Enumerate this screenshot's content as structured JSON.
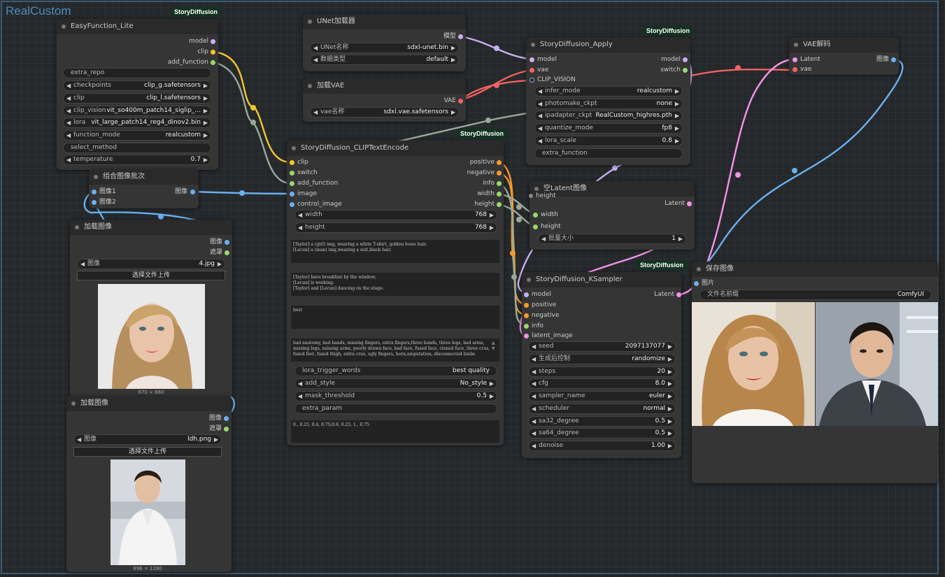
{
  "group_title": "RealCustom",
  "badge_label": "StoryDiffusion",
  "easy": {
    "title": "EasyFunction_Lite",
    "outputs": [
      "model",
      "clip",
      "add_function"
    ],
    "extra_repo": "extra_repo",
    "widgets": [
      {
        "label": "checkpoints",
        "value": "clip_g.safetensors"
      },
      {
        "label": "clip",
        "value": "clip_l.safetensors"
      },
      {
        "label": "clip_vision",
        "value": "vit_so400m_patch14_siglip_..."
      },
      {
        "label": "lora",
        "value": "vit_large_patch14_reg4_dinov2.bin"
      },
      {
        "label": "function_mode",
        "value": "realcustom"
      }
    ],
    "select_method": "select_method",
    "temperature": {
      "label": "temperature",
      "value": "0.7"
    }
  },
  "unet": {
    "title": "UNet加载器",
    "output": "模型",
    "widgets": [
      {
        "label": "UNet名称",
        "value": "sdxl-unet.bin"
      },
      {
        "label": "数据类型",
        "value": "default"
      }
    ]
  },
  "vae_loader": {
    "title": "加载VAE",
    "output": "VAE",
    "widget": {
      "label": "vae名称",
      "value": "sdxl.vae.safetensors"
    }
  },
  "apply": {
    "title": "StoryDiffusion_Apply",
    "inputs": [
      "model",
      "vae",
      "CLIP_VISION"
    ],
    "outputs": [
      "model",
      "switch"
    ],
    "widgets": [
      {
        "label": "infer_mode",
        "value": "realcustom"
      },
      {
        "label": "photomake_ckpt",
        "value": "none"
      },
      {
        "label": "ipadapter_ckpt",
        "value": "RealCustom_highres.pth"
      },
      {
        "label": "quantize_mode",
        "value": "fp8"
      },
      {
        "label": "lora_scale",
        "value": "0.8"
      }
    ],
    "extra_function": "extra_function"
  },
  "vae_decode": {
    "title": "VAE解码",
    "inputs": [
      "Latent",
      "vae"
    ],
    "output": "图像"
  },
  "combine": {
    "title": "组合图像批次",
    "inputs": [
      "图像1",
      "图像2"
    ],
    "output": "图像"
  },
  "clipenc": {
    "title": "StoryDiffusion_CLIPTextEncode",
    "inputs": [
      "clip",
      "switch",
      "add_function",
      "image",
      "control_image"
    ],
    "outputs": [
      "positive",
      "negative",
      "info",
      "width",
      "height"
    ],
    "width": {
      "label": "width",
      "value": "768"
    },
    "height": {
      "label": "height",
      "value": "768"
    },
    "text1": "[Taylor] a (girl) img, wearing a white T-shirt, golden loose hair.\n[Lecun] a (man) img,wearing a suit,black hair.",
    "text2": "[Taylor] have breakfast by the window;\n[Lecun] is working.\n[Taylor] and [Lecun] dancing on the stage.",
    "text3": "best",
    "text4": "bad anatomy, bad hands, missing fingers, extra fingers,three hands, three legs, bad arms, missing legs, missing arms, poorly drawn face, bad face, fused face, cloned face, three crus, fused feet, fused thigh, extra crus, ugly fingers, horn,amputation, disconnected limbs",
    "widgets": [
      {
        "label": "lora_trigger_words",
        "value": "best quality"
      },
      {
        "label": "add_style",
        "value": "No_style"
      },
      {
        "label": "mask_threshold",
        "value": "0.5"
      }
    ],
    "extra_param": "extra_param",
    "text5": "0., 0.25, 0.4, 0.75;0.6, 0.25, 1., 0.75"
  },
  "latent": {
    "title": "空Latent图像",
    "inputs": [
      "height",
      "width",
      "height"
    ],
    "output": "Latent",
    "batch": {
      "label": "批量大小",
      "value": "1"
    }
  },
  "ksampler": {
    "title": "StoryDiffusion_KSampler",
    "inputs": [
      "model",
      "positive",
      "negative",
      "info",
      "latent_image"
    ],
    "output": "Latent",
    "widgets": [
      {
        "label": "seed",
        "value": "2097137077"
      },
      {
        "label": "生成后控制",
        "value": "randomize"
      },
      {
        "label": "steps",
        "value": "20"
      },
      {
        "label": "cfg",
        "value": "8.0"
      },
      {
        "label": "sampler_name",
        "value": "euler"
      },
      {
        "label": "scheduler",
        "value": "normal"
      },
      {
        "label": "sa32_degree",
        "value": "0.5"
      },
      {
        "label": "sa64_degree",
        "value": "0.5"
      },
      {
        "label": "denoise",
        "value": "1.00"
      }
    ]
  },
  "load1": {
    "title": "加载图像",
    "outputs": [
      "图像",
      "遮罩"
    ],
    "widget": {
      "label": "图像",
      "value": "4.jpg"
    },
    "upload": "选择文件上传",
    "dims": "670 × 660"
  },
  "load2": {
    "title": "加载图像",
    "outputs": [
      "图像",
      "遮罩"
    ],
    "widget": {
      "label": "图像",
      "value": "ldh.png"
    },
    "upload": "选择文件上传",
    "dims": "896 × 1280"
  },
  "save": {
    "title": "保存图像",
    "input": "图片",
    "prefix": {
      "label": "文件名前缀",
      "value": "ComfyUI"
    }
  },
  "colors": {
    "clip": "#f5c52d",
    "conditioning": "#f59a2b",
    "int": "#9ad96b",
    "image": "#6ab1f0",
    "latent": "#f393e8",
    "vae": "#f36262",
    "model": "#c8b0f0"
  }
}
